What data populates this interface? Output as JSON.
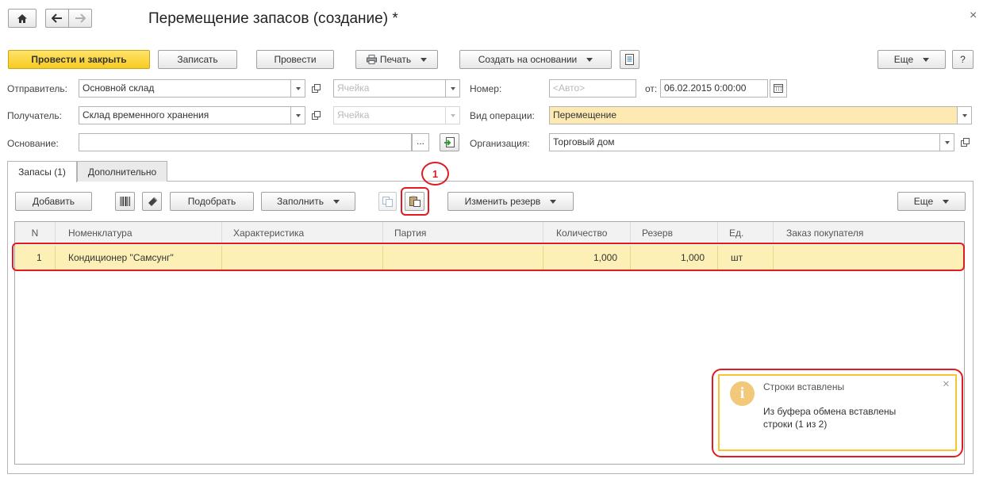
{
  "window": {
    "title": "Перемещение запасов (создание) *",
    "close": "×"
  },
  "toolbar": {
    "post_close": "Провести и закрыть",
    "save": "Записать",
    "post": "Провести",
    "print": "Печать",
    "create_based": "Создать на основании",
    "more": "Еще",
    "help": "?"
  },
  "form": {
    "sender_label": "Отправитель:",
    "sender_value": "Основной склад",
    "sender_cell_placeholder": "Ячейка",
    "receiver_label": "Получатель:",
    "receiver_value": "Склад временного хранения",
    "receiver_cell_placeholder": "Ячейка",
    "basis_label": "Основание:",
    "basis_value": "",
    "basis_select": "...",
    "number_label": "Номер:",
    "number_placeholder": "<Авто>",
    "from_label": "от:",
    "date_value": "06.02.2015  0:00:00",
    "operation_label": "Вид операции:",
    "operation_value": "Перемещение",
    "org_label": "Организация:",
    "org_value": "Торговый дом"
  },
  "tabs": [
    {
      "label": "Запасы (1)",
      "active": true
    },
    {
      "label": "Дополнительно",
      "active": false
    }
  ],
  "table_toolbar": {
    "add": "Добавить",
    "pick": "Подобрать",
    "fill": "Заполнить",
    "change_reserve": "Изменить резерв",
    "more": "Еще"
  },
  "annotation": {
    "number": "1"
  },
  "table": {
    "columns": [
      "N",
      "Номенклатура",
      "Характеристика",
      "Партия",
      "Количество",
      "Резерв",
      "Ед.",
      "Заказ покупателя"
    ],
    "rows": [
      {
        "n": "1",
        "item": "Кондиционер \"Самсунг\"",
        "characteristic": "",
        "batch": "",
        "quantity": "1,000",
        "reserve": "1,000",
        "unit": "шт",
        "order": ""
      }
    ]
  },
  "notification": {
    "title": "Строки вставлены",
    "message": "Из буфера обмена вставлены строки (1 из 2)",
    "close": "×"
  },
  "colors": {
    "primary_button": "#f7cc1f",
    "selected_row": "#fdf0b6",
    "highlight_field": "#fde9b1",
    "annotation_red": "#e01b24",
    "notification_border": "#f5c631",
    "info_icon": "#f2c97a"
  }
}
